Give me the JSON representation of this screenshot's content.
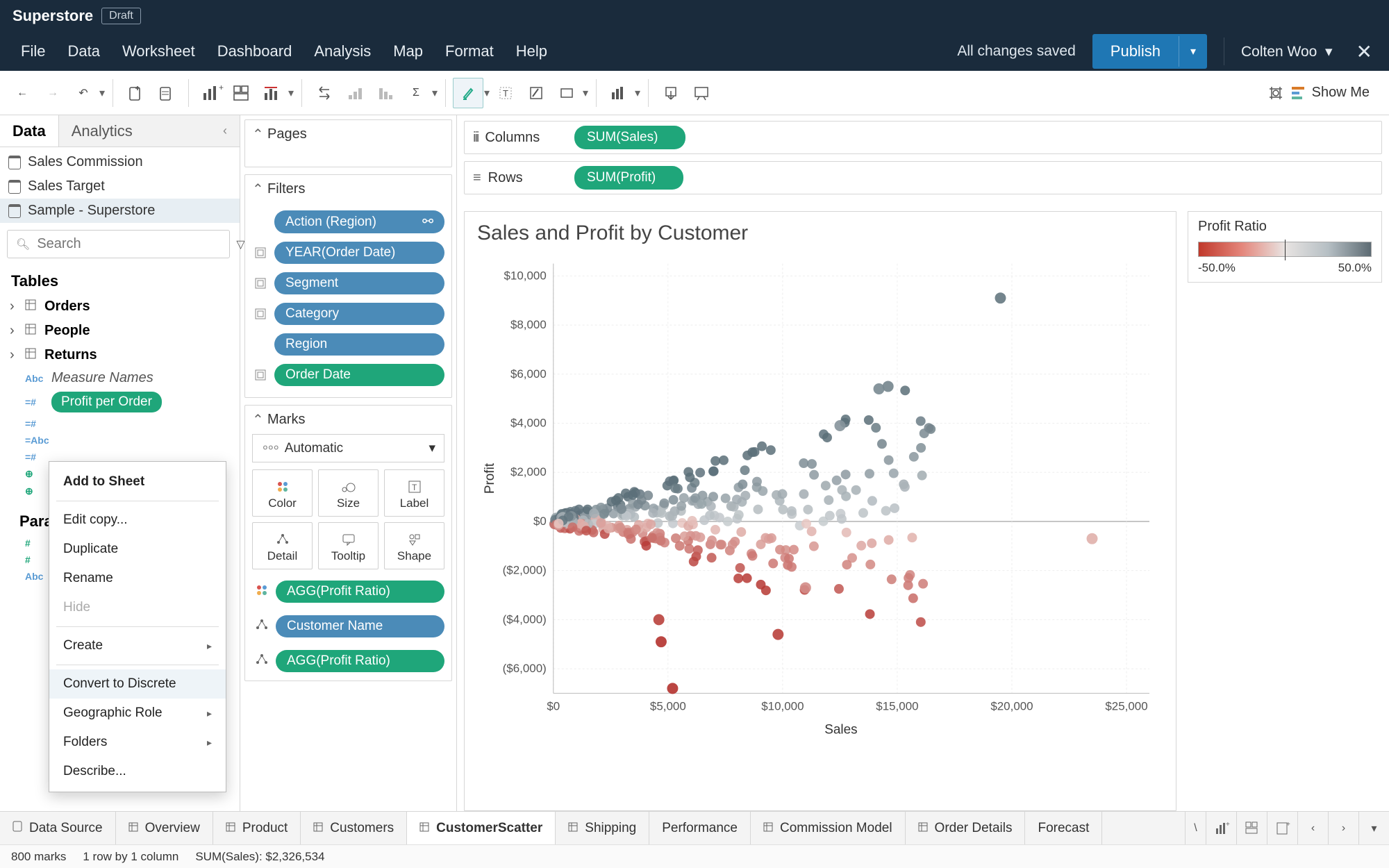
{
  "header": {
    "workbook": "Superstore",
    "badge": "Draft",
    "menu": [
      "File",
      "Data",
      "Worksheet",
      "Dashboard",
      "Analysis",
      "Map",
      "Format",
      "Help"
    ],
    "saved": "All changes saved",
    "publish": "Publish",
    "user": "Colten Woo"
  },
  "toolbar": {
    "show_me": "Show Me"
  },
  "side": {
    "tab_data": "Data",
    "tab_analytics": "Analytics",
    "datasources": [
      "Sales Commission",
      "Sales Target",
      "Sample - Superstore"
    ],
    "search_placeholder": "Search",
    "tables_h": "Tables",
    "tables": [
      "Orders",
      "People",
      "Returns"
    ],
    "measure_names": "Measure Names",
    "profit_per_order": "Profit per Order",
    "parameters_h": "Parameters"
  },
  "context_menu": {
    "add": "Add to Sheet",
    "edit": "Edit copy...",
    "dup": "Duplicate",
    "rename": "Rename",
    "hide": "Hide",
    "create": "Create",
    "convert": "Convert to Discrete",
    "geo": "Geographic Role",
    "folders": "Folders",
    "describe": "Describe..."
  },
  "mid": {
    "pages": "Pages",
    "filters": "Filters",
    "filter_pills": [
      {
        "label": "Action (Region)",
        "kind": "blue",
        "link": true
      },
      {
        "label": "YEAR(Order Date)",
        "kind": "blue",
        "ctx": true
      },
      {
        "label": "Segment",
        "kind": "blue",
        "ctx": true
      },
      {
        "label": "Category",
        "kind": "blue",
        "ctx": true
      },
      {
        "label": "Region",
        "kind": "blue"
      },
      {
        "label": "Order Date",
        "kind": "green",
        "ctx": true
      }
    ],
    "marks": "Marks",
    "marks_mode": "Automatic",
    "mark_cells": [
      "Color",
      "Size",
      "Label",
      "Detail",
      "Tooltip",
      "Shape"
    ],
    "mark_pills": [
      {
        "label": "AGG(Profit Ratio)",
        "icon": "color"
      },
      {
        "label": "Customer Name",
        "icon": "detail"
      },
      {
        "label": "AGG(Profit Ratio)",
        "icon": "detail"
      }
    ]
  },
  "shelves": {
    "columns": "Columns",
    "rows": "Rows",
    "col_pill": "SUM(Sales)",
    "row_pill": "SUM(Profit)"
  },
  "viz": {
    "title": "Sales and Profit by Customer",
    "legend_title": "Profit Ratio",
    "legend_min": "-50.0%",
    "legend_max": "50.0%"
  },
  "chart_data": {
    "type": "scatter",
    "xlabel": "Sales",
    "ylabel": "Profit",
    "xlim": [
      0,
      26000
    ],
    "ylim": [
      -7000,
      10500
    ],
    "xticks": [
      0,
      5000,
      10000,
      15000,
      20000,
      25000
    ],
    "yticks": [
      -6000,
      -4000,
      -2000,
      0,
      2000,
      4000,
      6000,
      8000,
      10000
    ],
    "xtick_labels": [
      "$0",
      "$5,000",
      "$10,000",
      "$15,000",
      "$20,000",
      "$25,000"
    ],
    "ytick_labels": [
      "($6,000)",
      "($4,000)",
      "($2,000)",
      "$0",
      "$2,000",
      "$4,000",
      "$6,000",
      "$8,000",
      "$10,000"
    ],
    "color_field": "profit_ratio",
    "color_domain": [
      -0.5,
      0.5
    ],
    "points_seed": 1,
    "points_n": 380
  },
  "bottom_tabs": [
    "Data Source",
    "Overview",
    "Product",
    "Customers",
    "CustomerScatter",
    "Shipping",
    "Performance",
    "Commission Model",
    "Order Details",
    "Forecast"
  ],
  "bottom_active": "CustomerScatter",
  "status": {
    "marks": "800 marks",
    "layout": "1 row by 1 column",
    "sum": "SUM(Sales): $2,326,534"
  }
}
